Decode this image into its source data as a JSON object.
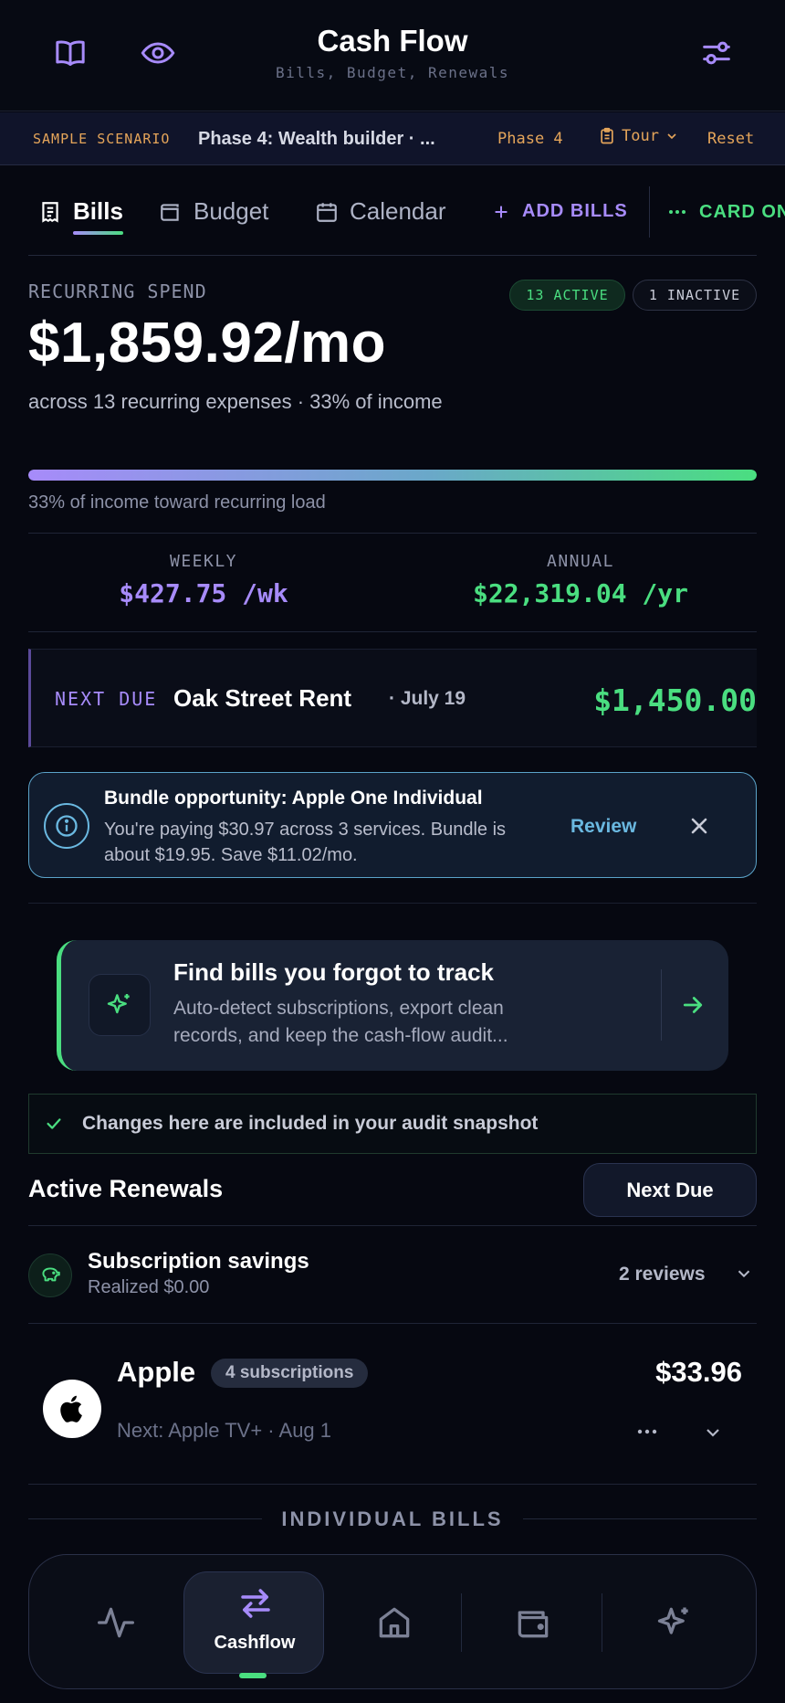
{
  "header": {
    "title": "Cash Flow",
    "subtitle": "Bills, Budget, Renewals",
    "icons": [
      "book-icon",
      "eye-icon",
      "sliders-icon"
    ]
  },
  "scenario": {
    "tag": "SAMPLE SCENARIO",
    "name": "Phase 4: Wealth builder · ...",
    "phase": "Phase 4",
    "tour": "Tour",
    "reset": "Reset"
  },
  "tabs": {
    "bills": "Bills",
    "budget": "Budget",
    "calendar": "Calendar",
    "add_bills": "ADD BILLS",
    "card_on": "CARD ON"
  },
  "recurring": {
    "label": "RECURRING SPEND",
    "active_badge": "13 ACTIVE",
    "inactive_badge": "1 INACTIVE",
    "amount": "$1,859.92/mo",
    "description": "across 13 recurring expenses · 33% of income",
    "income_share": 33,
    "bar_caption": "33% of income toward recurring load"
  },
  "stats": {
    "weekly_label": "WEEKLY",
    "weekly_value": "$427.75 /wk",
    "annual_label": "ANNUAL",
    "annual_value": "$22,319.04 /yr"
  },
  "next_due": {
    "label": "NEXT DUE",
    "name": "Oak Street Rent",
    "date": "· July 19",
    "amount": "$1,450.00"
  },
  "bundle": {
    "title": "Bundle opportunity: Apple One Individual",
    "description": "You're paying $30.97 across 3 services. Bundle is about $19.95. Save $11.02/mo.",
    "review": "Review"
  },
  "find_bills": {
    "title": "Find bills you forgot to track",
    "description": "Auto-detect subscriptions, export clean records, and keep the cash-flow audit..."
  },
  "audit_note": "Changes here are included in your audit snapshot",
  "renewals": {
    "title": "Active Renewals",
    "sort_button": "Next Due",
    "savings_title": "Subscription savings",
    "savings_sub": "Realized $0.00",
    "savings_reviews": "2 reviews",
    "apple_name": "Apple",
    "apple_badge": "4 subscriptions",
    "apple_amount": "$33.96",
    "apple_next": "Next: Apple TV+ · Aug 1"
  },
  "individual_bills_label": "INDIVIDUAL BILLS",
  "bottom_nav": {
    "active_label": "Cashflow",
    "items": [
      "activity-icon",
      "cashflow-icon",
      "home-icon",
      "wallet-icon",
      "sparkles-icon"
    ]
  },
  "colors": {
    "accent_purple": "#a78bfa",
    "accent_green": "#4ade80",
    "accent_orange": "#e5a55a",
    "accent_blue": "#6ab8e0",
    "background": "#060811"
  }
}
